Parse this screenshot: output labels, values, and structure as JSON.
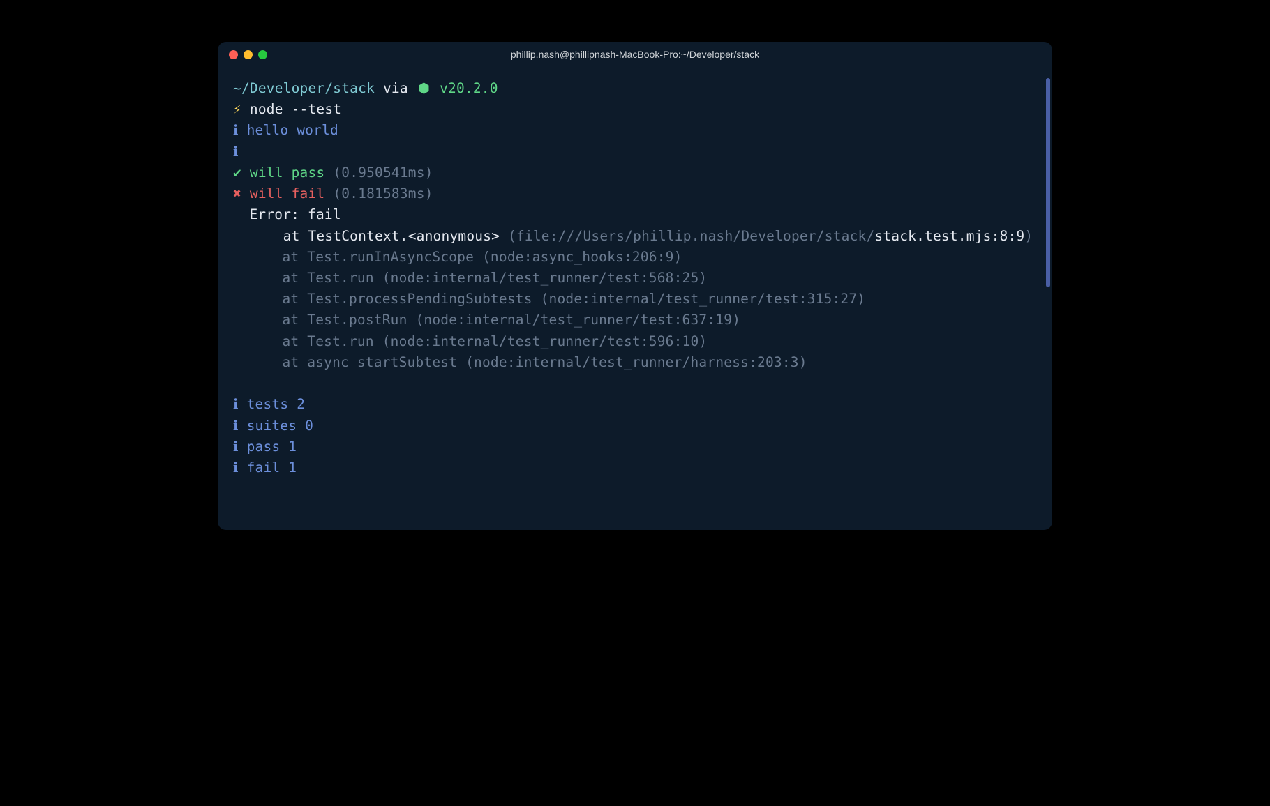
{
  "window": {
    "title": "phillip.nash@phillipnash-MacBook-Pro:~/Developer/stack"
  },
  "prompt": {
    "path": "~/Developer/stack",
    "via": "via",
    "node_icon": "⬢",
    "node_version": "v20.2.0",
    "symbol": "⚡",
    "command": "node --test"
  },
  "output": {
    "info_icon": "ℹ",
    "check_icon": "✔",
    "cross_icon": "✖",
    "diag1": "hello world",
    "pass_name": "will pass",
    "pass_time": "(0.950541ms)",
    "fail_name": "will fail",
    "fail_time": "(0.181583ms)",
    "error_header": "Error: fail",
    "stack_at1_prefix": "at TestContext.<anonymous> ",
    "stack_at1_mid": "(file:///Users/phillip.nash/Developer/stack/",
    "stack_at1_file": "stack.test.mjs:8:9",
    "stack_at1_close": ")",
    "stack2": "at Test.runInAsyncScope (node:async_hooks:206:9)",
    "stack3": "at Test.run (node:internal/test_runner/test:568:25)",
    "stack4": "at Test.processPendingSubtests (node:internal/test_runner/test:315:27)",
    "stack5": "at Test.postRun (node:internal/test_runner/test:637:19)",
    "stack6": "at Test.run (node:internal/test_runner/test:596:10)",
    "stack7": "at async startSubtest (node:internal/test_runner/harness:203:3)"
  },
  "summary": {
    "tests": "tests 2",
    "suites": "suites 0",
    "pass": "pass 1",
    "fail": "fail 1"
  }
}
